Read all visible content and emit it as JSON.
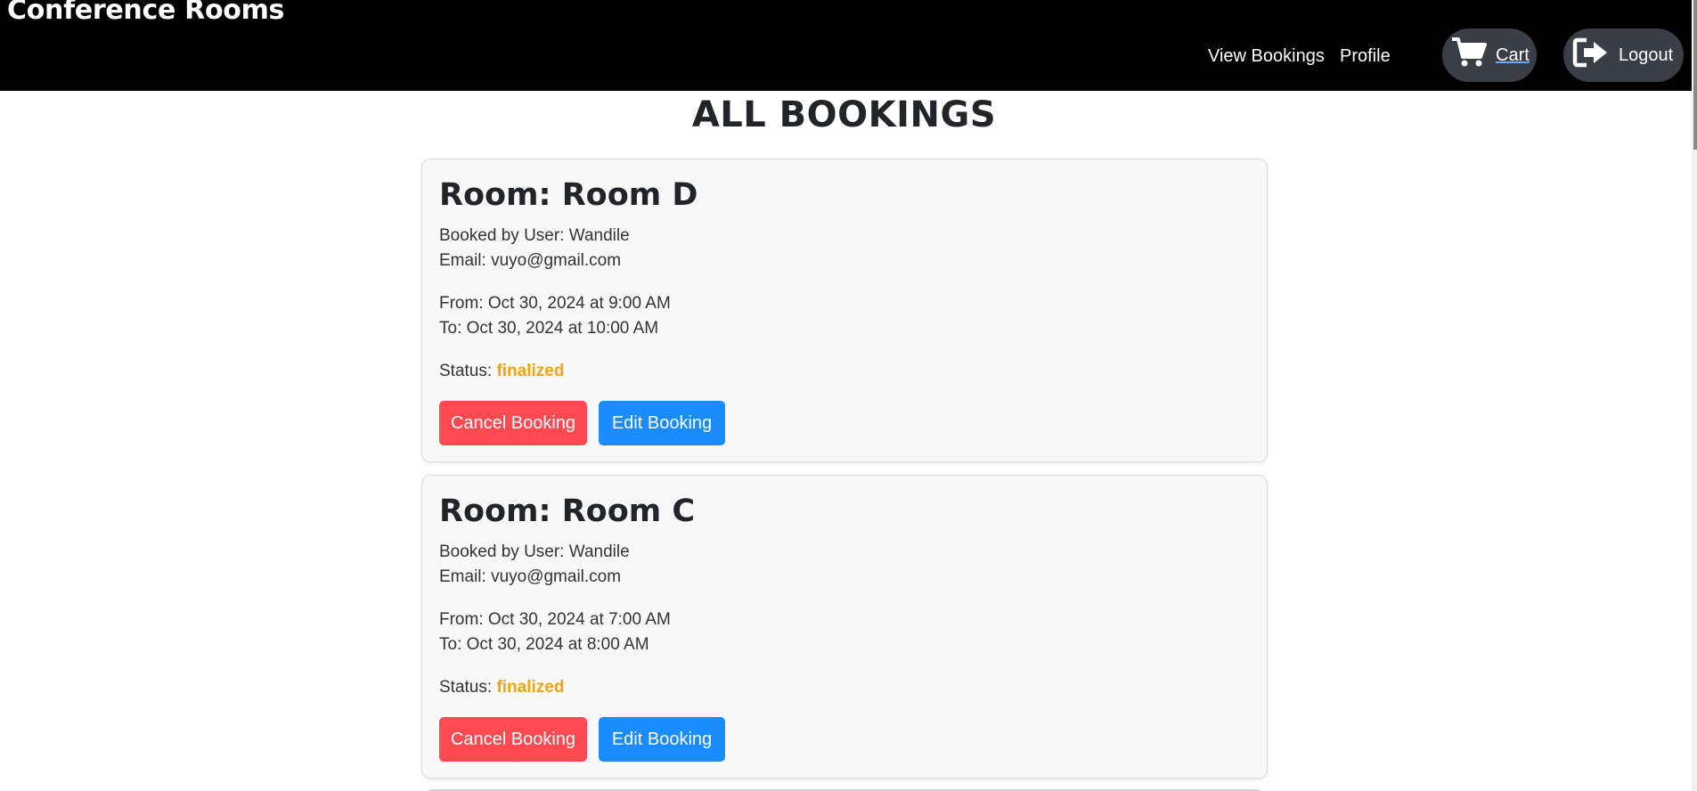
{
  "navbar": {
    "brand": "Conference Rooms",
    "links": {
      "view_bookings": "View Bookings",
      "profile": "Profile",
      "cart": "Cart",
      "logout": "Logout"
    },
    "icons": {
      "cart": "cart-icon",
      "logout": "logout-icon"
    },
    "background_color": "#000000"
  },
  "page": {
    "title": "ALL BOOKINGS"
  },
  "bookings": [
    {
      "room": "Room: Room D",
      "booked_by": "Booked by User: Wandile",
      "email": "Email: vuyo@gmail.com",
      "from": "From: Oct 30, 2024 at 9:00 AM",
      "to": "To: Oct 30, 2024 at 10:00 AM",
      "status_label": "Status:",
      "status_value": "finalized",
      "cancel_label": "Cancel Booking",
      "edit_label": "Edit Booking"
    },
    {
      "room": "Room: Room C",
      "booked_by": "Booked by User: Wandile",
      "email": "Email: vuyo@gmail.com",
      "from": "From: Oct 30, 2024 at 7:00 AM",
      "to": "To: Oct 30, 2024 at 8:00 AM",
      "status_label": "Status:",
      "status_value": "finalized",
      "cancel_label": "Cancel Booking",
      "edit_label": "Edit Booking"
    }
  ],
  "colors": {
    "cancel_button": "#ff4a52",
    "edit_button": "#1a8cff",
    "status_finalized": "#f5a20b",
    "card_background": "#f8f8f8"
  }
}
